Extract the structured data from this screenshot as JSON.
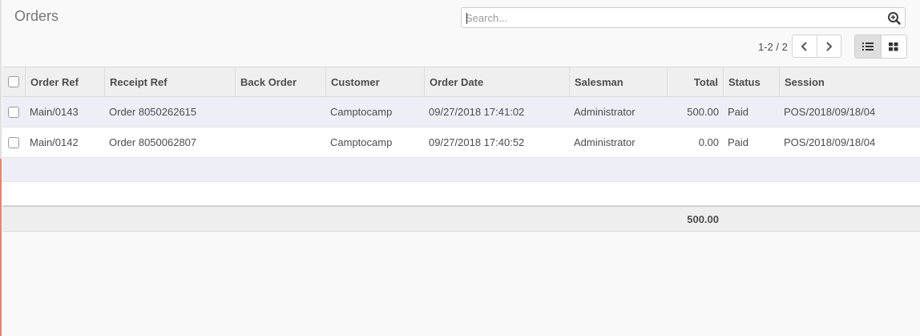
{
  "page": {
    "title": "Orders"
  },
  "search": {
    "placeholder": "Search..."
  },
  "pager": {
    "value": "1-2 / 2"
  },
  "views": {
    "active": "list"
  },
  "table": {
    "columns": {
      "order_ref": "Order Ref",
      "receipt_ref": "Receipt Ref",
      "back_order": "Back Order",
      "customer": "Customer",
      "order_date": "Order Date",
      "salesman": "Salesman",
      "total": "Total",
      "status": "Status",
      "session": "Session"
    },
    "rows": [
      {
        "order_ref": "Main/0143",
        "receipt_ref": "Order 8050262615",
        "back_order": "",
        "customer": "Camptocamp",
        "order_date": "09/27/2018 17:41:02",
        "salesman": "Administrator",
        "total": "500.00",
        "status": "Paid",
        "session": "POS/2018/09/18/04"
      },
      {
        "order_ref": "Main/0142",
        "receipt_ref": "Order 8050062807",
        "back_order": "",
        "customer": "Camptocamp",
        "order_date": "09/27/2018 17:40:52",
        "salesman": "Administrator",
        "total": "0.00",
        "status": "Paid",
        "session": "POS/2018/09/18/04"
      }
    ],
    "footer": {
      "total": "500.00"
    }
  }
}
